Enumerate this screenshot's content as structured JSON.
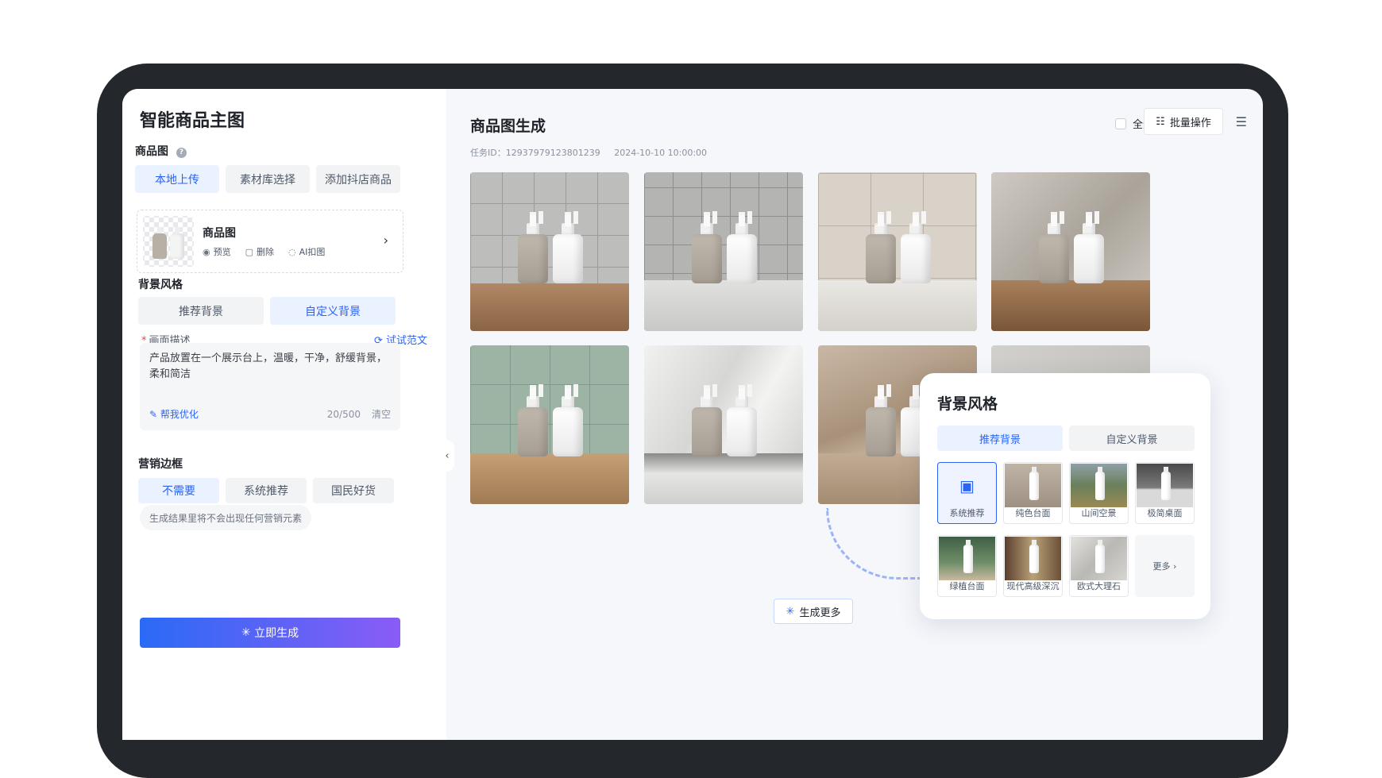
{
  "sidebar": {
    "app_title": "智能商品主图",
    "product_section": "商品图",
    "upload_tabs": [
      "本地上传",
      "素材库选择",
      "添加抖店商品"
    ],
    "upload_card": {
      "title": "商品图",
      "preview": "预览",
      "delete": "删除",
      "ai_cutout": "AI扣图"
    },
    "bg_section": "背景风格",
    "bg_tabs": [
      "推荐背景",
      "自定义背景"
    ],
    "desc_label": "画面描述",
    "try_example": "试试范文",
    "desc_text": "产品放置在一个展示台上，温暖，干净，舒缓背景，柔和简洁",
    "optimize": "帮我优化",
    "char_count": "20/500",
    "clear": "清空",
    "marketing_section": "营销边框",
    "marketing_tabs": [
      "不需要",
      "系统推荐",
      "国民好货"
    ],
    "marketing_hint": "生成结果里将不会出现任何营销元素",
    "generate_button": "立即生成"
  },
  "main": {
    "title": "商品图生成",
    "task_id": "任务ID：12937979123801239",
    "timestamp": "2024-10-10 10:00:00",
    "select_all": "全选",
    "batch_ops": "批量操作",
    "generate_more": "生成更多"
  },
  "popup": {
    "title": "背景风格",
    "tabs": [
      "推荐背景",
      "自定义背景"
    ],
    "styles": [
      "系统推荐",
      "纯色台面",
      "山间空景",
      "极简桌面",
      "绿植台面",
      "现代高级深沉",
      "欧式大理石"
    ],
    "more": "更多"
  },
  "colors": {
    "accent": "#2a63f6",
    "gradient_start": "#2a6af6",
    "gradient_end": "#8a5cf6"
  }
}
